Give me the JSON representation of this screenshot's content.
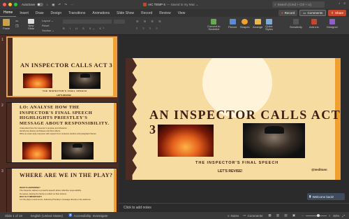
{
  "titlebar": {
    "autosave": "AutoSave",
    "doc_title": "AIC TEMP 6",
    "doc_status": "— Saved to my Mac ⌄",
    "search_placeholder": "Search (Cmd + Ctrl + U)"
  },
  "tabs": [
    "Home",
    "Insert",
    "Draw",
    "Design",
    "Transitions",
    "Animations",
    "Slide Show",
    "Record",
    "Review",
    "View"
  ],
  "tab_buttons": {
    "record": "Record",
    "comments": "Comments",
    "share": "Share"
  },
  "ribbon": {
    "paste": "Paste",
    "new_slide": "New\nSlide",
    "layout": "Layout ⌄",
    "reset": "Reset",
    "section": "Section ⌄",
    "convert": "Convert to\nSmartArt",
    "picture": "Picture",
    "shapes": "Shapes",
    "arrange": "Arrange",
    "quick_styles": "Quick\nStyles",
    "sensitivity": "Sensitivity",
    "add_ins": "Add-ins",
    "designer": "Designer"
  },
  "thumbs": [
    {
      "num": "1",
      "title": "AN INSPECTOR CALLS ACT 3",
      "subtitle": "THE INSPECTOR'S FINAL SPEECH",
      "revise": "LET'S REVISE!"
    },
    {
      "num": "2",
      "title": "LO: ANALYSE HOW THE INSPECTOR'S FINAL SPEECH HIGHLIGHTS PRIESTLEY'S MESSAGE ABOUT RESPONSIBILITY.",
      "b1": "Understand how the inspector's purpose and character",
      "b2": "Identify key literary techniques and their effects",
      "b3": "Write an exam-style response with support from sentence starters and paragraph frames"
    },
    {
      "num": "3",
      "title": "WHERE ARE WE IN THE PLAY?",
      "h1": "WHAT'S HAPPENING?",
      "p1": "The Inspector delivers a powerful speech about collective responsibility.",
      "p2": "He leaves, leaving the family to reflect on their actions.",
      "h2": "WHY IS IT IMPORTANT?",
      "p3": "It is the play's moral centre, delivering Priestley's message directly to the audience."
    }
  ],
  "slide": {
    "title": "AN INSPECTOR CALLS ACT 3",
    "subtitle": "THE INSPECTOR'S FINAL SPEECH",
    "revise": "LET'S REVISE!",
    "handle": "@teslitsen"
  },
  "notes_placeholder": "Click to add notes",
  "welcome": "Welcome back!",
  "status": {
    "slide": "Slide 1 of 10",
    "language": "English (United States)",
    "accessibility": "Accessibility: Investigate",
    "notes": "Notes",
    "comments": "Comments",
    "zoom": "83%"
  },
  "colors": {
    "accent": "#c4472b",
    "slide_bg": "#f7dca2",
    "title_brown": "#3d1e12",
    "sidebar": "#4c2c22"
  }
}
